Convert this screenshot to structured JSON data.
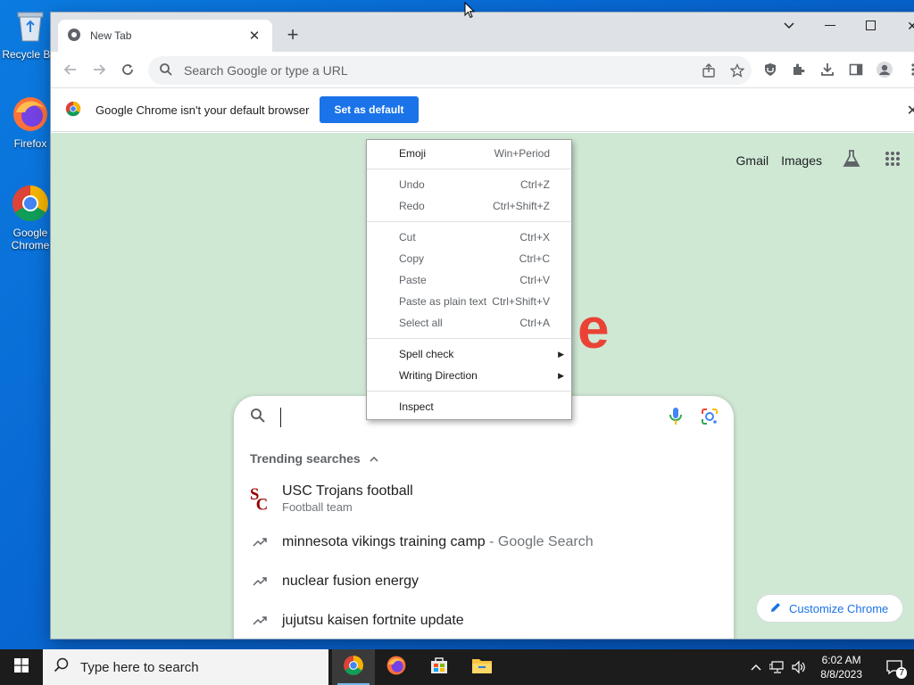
{
  "desktop": {
    "icons": [
      {
        "label": "Recycle Bin",
        "icon": "recycle-bin-icon"
      },
      {
        "label": "Firefox",
        "icon": "firefox-icon"
      },
      {
        "label": "Google Chrome",
        "icon": "chrome-icon"
      }
    ]
  },
  "browser": {
    "tab": {
      "title": "New Tab"
    },
    "omnibox": {
      "placeholder": "Search Google or type a URL"
    },
    "infobar": {
      "message": "Google Chrome isn't your default browser",
      "button": "Set as default"
    },
    "ntp": {
      "links": [
        "Gmail",
        "Images"
      ],
      "trending_header": "Trending searches",
      "suggestions": [
        {
          "text": "USC Trojans football",
          "sub": "Football team",
          "icon": "usc-logo-icon"
        },
        {
          "text": "minnesota vikings training camp",
          "sub": " - Google Search",
          "icon": "trending-icon"
        },
        {
          "text": "nuclear fusion energy",
          "sub": "",
          "icon": "trending-icon"
        },
        {
          "text": "jujutsu kaisen fortnite update",
          "sub": "",
          "icon": "trending-icon"
        }
      ],
      "customize": "Customize Chrome"
    }
  },
  "context_menu": {
    "items": [
      {
        "label": "Emoji",
        "shortcut": "Win+Period"
      },
      {
        "label": "Undo",
        "shortcut": "Ctrl+Z"
      },
      {
        "label": "Redo",
        "shortcut": "Ctrl+Shift+Z"
      },
      {
        "label": "Cut",
        "shortcut": "Ctrl+X"
      },
      {
        "label": "Copy",
        "shortcut": "Ctrl+C"
      },
      {
        "label": "Paste",
        "shortcut": "Ctrl+V"
      },
      {
        "label": "Paste as plain text",
        "shortcut": "Ctrl+Shift+V"
      },
      {
        "label": "Select all",
        "shortcut": "Ctrl+A"
      },
      {
        "label": "Spell check",
        "shortcut": ""
      },
      {
        "label": "Writing Direction",
        "shortcut": ""
      },
      {
        "label": "Inspect",
        "shortcut": ""
      }
    ]
  },
  "taskbar": {
    "search_placeholder": "Type here to search",
    "time": "6:02 AM",
    "date": "8/8/2023",
    "notification_count": "7"
  },
  "colors": {
    "accent": "#1a73e8",
    "ntp_bg": "#cfe8d4",
    "taskbar": "#1c1c1c"
  }
}
